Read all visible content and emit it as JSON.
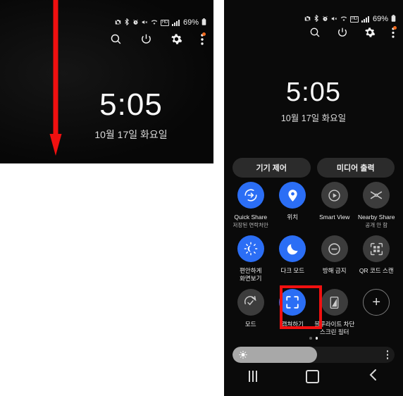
{
  "device": {
    "statusbar": {
      "icons": [
        "camera-blocked-icon",
        "bluetooth-icon",
        "alarm-icon",
        "mute-icon",
        "wifi-icon",
        "hd-voice-icon",
        "signal-bars-icon"
      ],
      "hd_label": "HD",
      "battery_percent": "69%",
      "battery_icon": "battery-icon"
    },
    "action_icons": [
      "search-icon",
      "power-icon",
      "settings-gear-icon",
      "overflow-menu-icon"
    ],
    "clock": "5:05",
    "date": "10월 17일 화요일"
  },
  "left_panel": {
    "annotation": {
      "arrow": "red-down-arrow",
      "arrow_color": "#f01010"
    }
  },
  "right_panel": {
    "pills": [
      {
        "label": "기기 제어"
      },
      {
        "label": "미디어 출력"
      }
    ],
    "tiles": [
      [
        {
          "label": "Quick Share",
          "sub": "저장된 연락처만",
          "icon": "quick-share-icon",
          "state": "on"
        },
        {
          "label": "위치",
          "sub": "",
          "icon": "location-pin-icon",
          "state": "on"
        },
        {
          "label": "Smart View",
          "sub": "",
          "icon": "smart-view-icon",
          "state": "off"
        },
        {
          "label": "Nearby Share",
          "sub": "공개 안 함",
          "icon": "nearby-share-icon",
          "state": "off"
        }
      ],
      [
        {
          "label": "편안하게\n화면보기",
          "sub": "",
          "icon": "eye-comfort-icon",
          "state": "on"
        },
        {
          "label": "다크 모드",
          "sub": "",
          "icon": "dark-mode-moon-icon",
          "state": "on"
        },
        {
          "label": "방해 금지",
          "sub": "",
          "icon": "do-not-disturb-icon",
          "state": "off"
        },
        {
          "label": "QR 코드 스캔",
          "sub": "",
          "icon": "qr-code-scan-icon",
          "state": "off"
        }
      ],
      [
        {
          "label": "모드",
          "sub": "",
          "icon": "modes-icon",
          "state": "off"
        },
        {
          "label": "캡쳐하기",
          "sub": "",
          "icon": "screen-capture-icon",
          "state": "on"
        },
        {
          "label": "블루라이트 차단\n스크린 필터",
          "sub": "",
          "icon": "blue-light-filter-icon",
          "state": "off"
        },
        {
          "label": "",
          "sub": "",
          "icon": "add-button-icon",
          "state": "add"
        }
      ]
    ],
    "highlight": {
      "target": "캡쳐하기",
      "color": "#f01010"
    },
    "page_indicator": {
      "total": 2,
      "active": 2
    },
    "brightness": {
      "percent": 52,
      "icon": "brightness-sun-icon",
      "menu_icon": "overflow-menu-icon"
    },
    "navbar": [
      "recents-icon",
      "home-icon",
      "back-icon"
    ]
  },
  "colors": {
    "accent_blue": "#2b6ef5",
    "tile_off": "#3c3c3c",
    "annotation_red": "#f01010",
    "badge_orange": "#f06a1e"
  }
}
